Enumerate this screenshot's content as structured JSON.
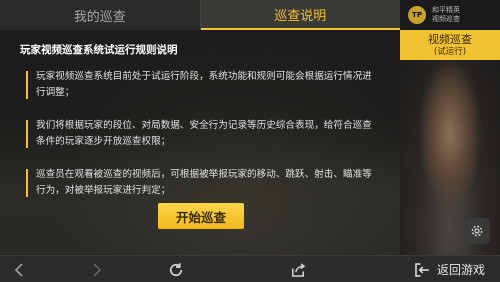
{
  "tabs": {
    "mine": "我的巡查",
    "rules": "巡查说明"
  },
  "content": {
    "title": "玩家视频巡查系统试运行规则说明",
    "rules": [
      "玩家视频巡查系统目前处于试运行阶段，系统功能和规则可能会根据运行情况进行调整；",
      "我们将根据玩家的段位、对局数据、安全行为记录等历史综合表现，给符合巡查条件的玩家逐步开放巡查权限；",
      "巡查员在观看被巡查的视频后，可根据被举报玩家的移动、跳跃、射击、瞄准等行为，对被举报玩家进行判定；"
    ],
    "start_button": "开始巡查"
  },
  "side": {
    "logo_text": "TP",
    "brand_line1": "和平精英",
    "brand_line2": "视频巡查",
    "active_title": "视频巡查",
    "active_sub": "(试运行)"
  },
  "navbar": {
    "back_game": "返回游戏"
  },
  "colors": {
    "accent": "#f1c232",
    "panel": "#2b2b2b"
  }
}
